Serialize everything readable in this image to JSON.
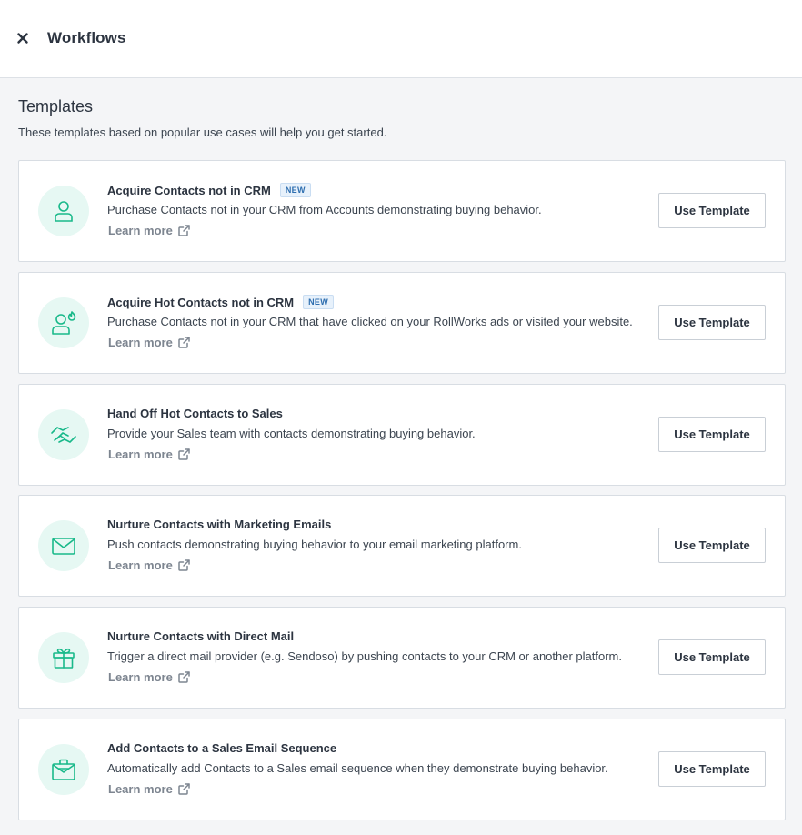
{
  "header": {
    "title": "Workflows",
    "close_icon": "close-icon"
  },
  "templates": {
    "title": "Templates",
    "subtitle": "These templates based on popular use cases will help you get started.",
    "items": [
      {
        "title": "Acquire Contacts not in CRM",
        "badge": "NEW",
        "description": "Purchase Contacts not in your CRM from Accounts demonstrating buying behavior.",
        "link": "Learn more",
        "button": "Use Template",
        "icon": "person-icon"
      },
      {
        "title": "Acquire Hot Contacts not in CRM",
        "badge": "NEW",
        "description": "Purchase Contacts not in your CRM that have clicked on your RollWorks ads or visited your website.",
        "link": "Learn more",
        "button": "Use Template",
        "icon": "hot-person-icon"
      },
      {
        "title": "Hand Off Hot Contacts to Sales",
        "description": "Provide your Sales team with contacts demonstrating buying behavior.",
        "link": "Learn more",
        "button": "Use Template",
        "icon": "handshake-icon"
      },
      {
        "title": "Nurture Contacts with Marketing Emails",
        "description": "Push contacts demonstrating buying behavior to your email marketing platform.",
        "link": "Learn more",
        "button": "Use Template",
        "icon": "envelope-icon"
      },
      {
        "title": "Nurture Contacts with Direct Mail",
        "description": "Trigger a direct mail provider (e.g. Sendoso) by pushing contacts to your CRM or another platform.",
        "link": "Learn more",
        "button": "Use Template",
        "icon": "gift-icon"
      },
      {
        "title": "Add Contacts to a Sales Email Sequence",
        "description": "Automatically add Contacts to a Sales email sequence when they demonstrate buying behavior.",
        "link": "Learn more",
        "button": "Use Template",
        "icon": "briefcase-mail-icon"
      }
    ]
  },
  "colors": {
    "accent": "#19b98a",
    "icon_bg": "#e6f8f3",
    "badge_text": "#2f6fb0",
    "badge_bg": "#e7f1fb",
    "page_bg": "#f4f5f7"
  }
}
